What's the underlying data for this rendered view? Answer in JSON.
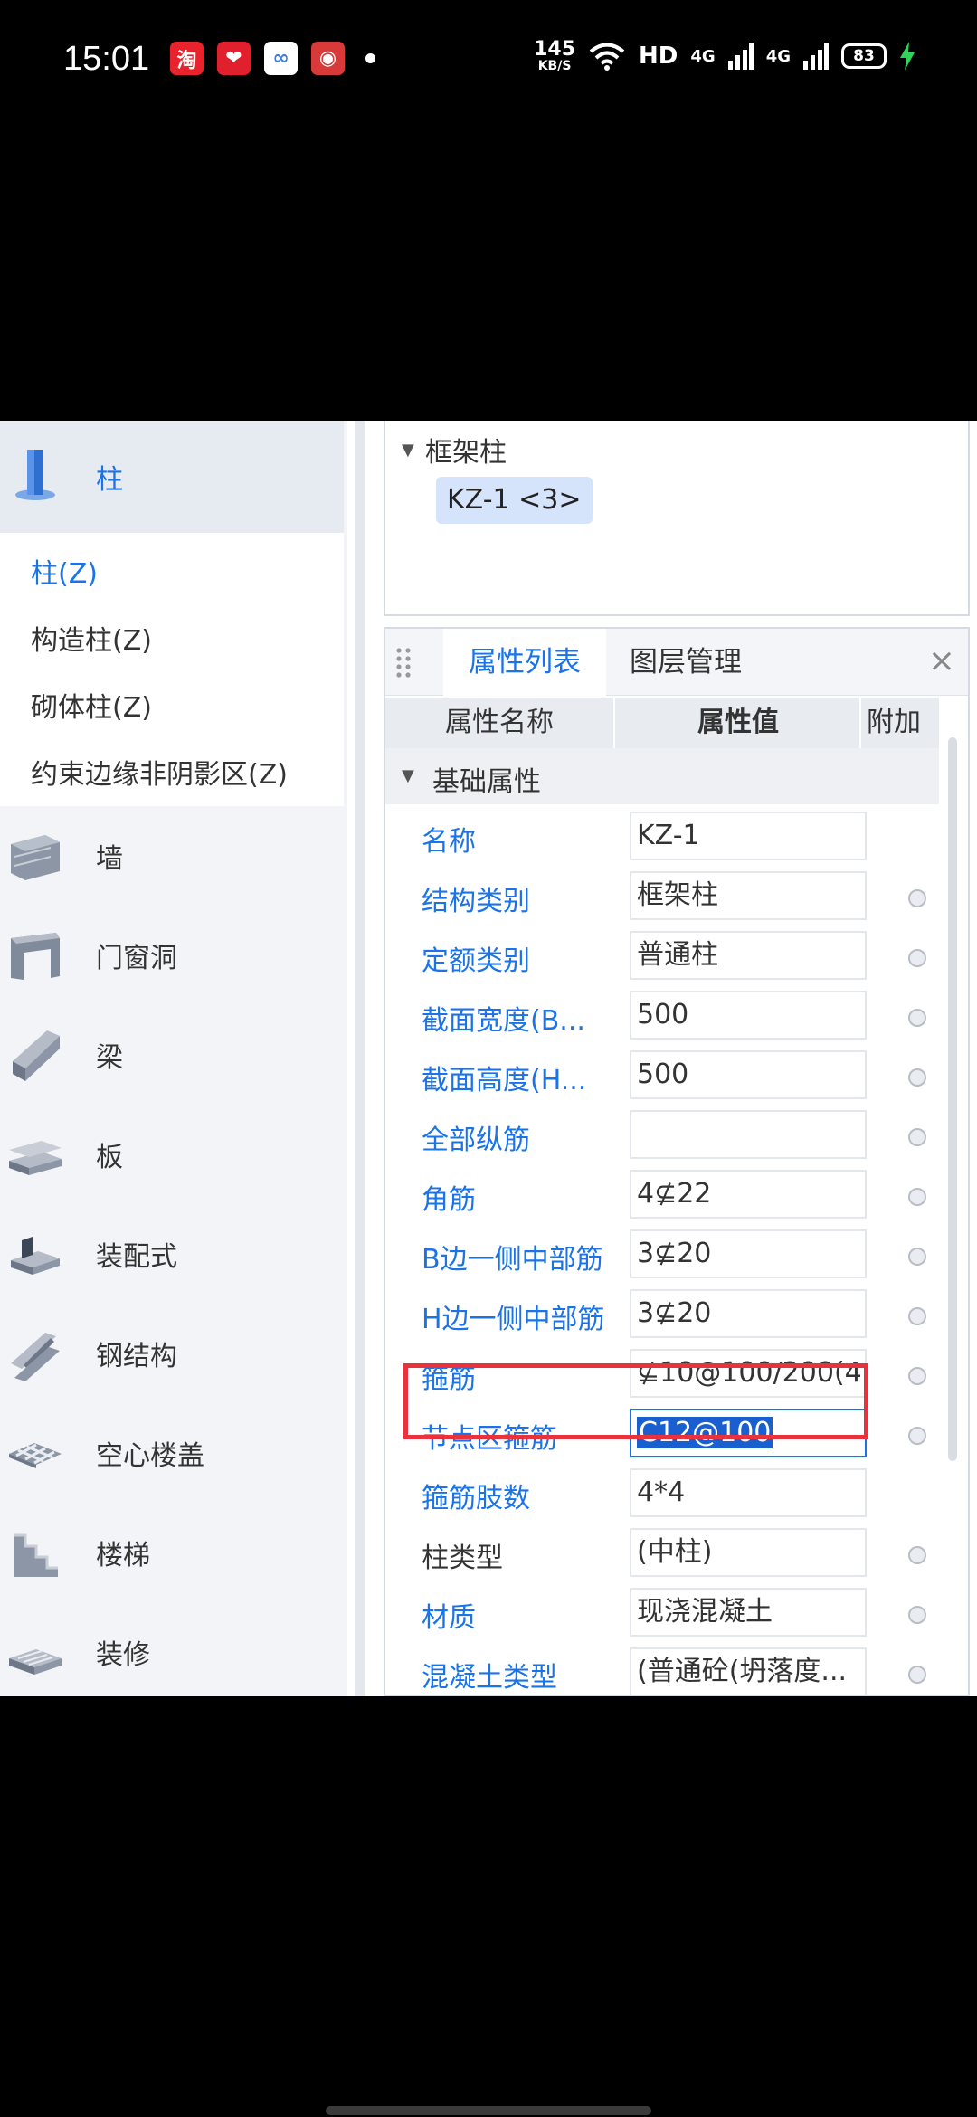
{
  "status_bar": {
    "time": "15:01",
    "apps": [
      {
        "name": "taobao-icon",
        "glyph": "淘",
        "color": "#e8232b"
      },
      {
        "name": "pinduoduo-icon",
        "glyph": "❤",
        "color": "#e0202c"
      },
      {
        "name": "cloud-app-icon",
        "glyph": "∞",
        "color": "#ffffff"
      },
      {
        "name": "game-app-icon",
        "glyph": "◉",
        "color": "#d83a3a"
      }
    ],
    "net_speed": "145",
    "net_unit": "KB/S",
    "hd": "HD",
    "sig1": "4G",
    "sig2": "4G",
    "battery": "83"
  },
  "sidebar": {
    "active_category": "柱",
    "subitems": [
      "柱(Z)",
      "构造柱(Z)",
      "砌体柱(Z)",
      "约束边缘非阴影区(Z)"
    ],
    "categories": [
      "墙",
      "门窗洞",
      "梁",
      "板",
      "装配式",
      "钢结构",
      "空心楼盖",
      "楼梯",
      "装修"
    ]
  },
  "tree": {
    "node": "框架柱",
    "leaf": "KZ-1 <3>"
  },
  "panel": {
    "tabs": [
      "属性列表",
      "图层管理"
    ],
    "close": "×",
    "columns": [
      "属性名称",
      "属性值",
      "附加"
    ],
    "group": "基础属性",
    "rows": [
      {
        "label": "名称",
        "value": "KZ-1"
      },
      {
        "label": "结构类别",
        "value": "框架柱"
      },
      {
        "label": "定额类别",
        "value": "普通柱"
      },
      {
        "label": "截面宽度(B...",
        "value": "500"
      },
      {
        "label": "截面高度(H...",
        "value": "500"
      },
      {
        "label": "全部纵筋",
        "value": ""
      },
      {
        "label": "角筋",
        "value": "4⊈22"
      },
      {
        "label": "B边一侧中部筋",
        "value": "3⊈20"
      },
      {
        "label": "H边一侧中部筋",
        "value": "3⊈20"
      },
      {
        "label": "箍筋",
        "value": "⊈10@100/200(4"
      },
      {
        "label": "节点区箍筋",
        "value": "C12@100"
      },
      {
        "label": "箍筋肢数",
        "value": "4*4"
      },
      {
        "label": "柱类型",
        "value": "(中柱)"
      },
      {
        "label": "材质",
        "value": "现浇混凝土"
      },
      {
        "label": "混凝土类型",
        "value": "(普通砼(坍落度..."
      }
    ]
  }
}
